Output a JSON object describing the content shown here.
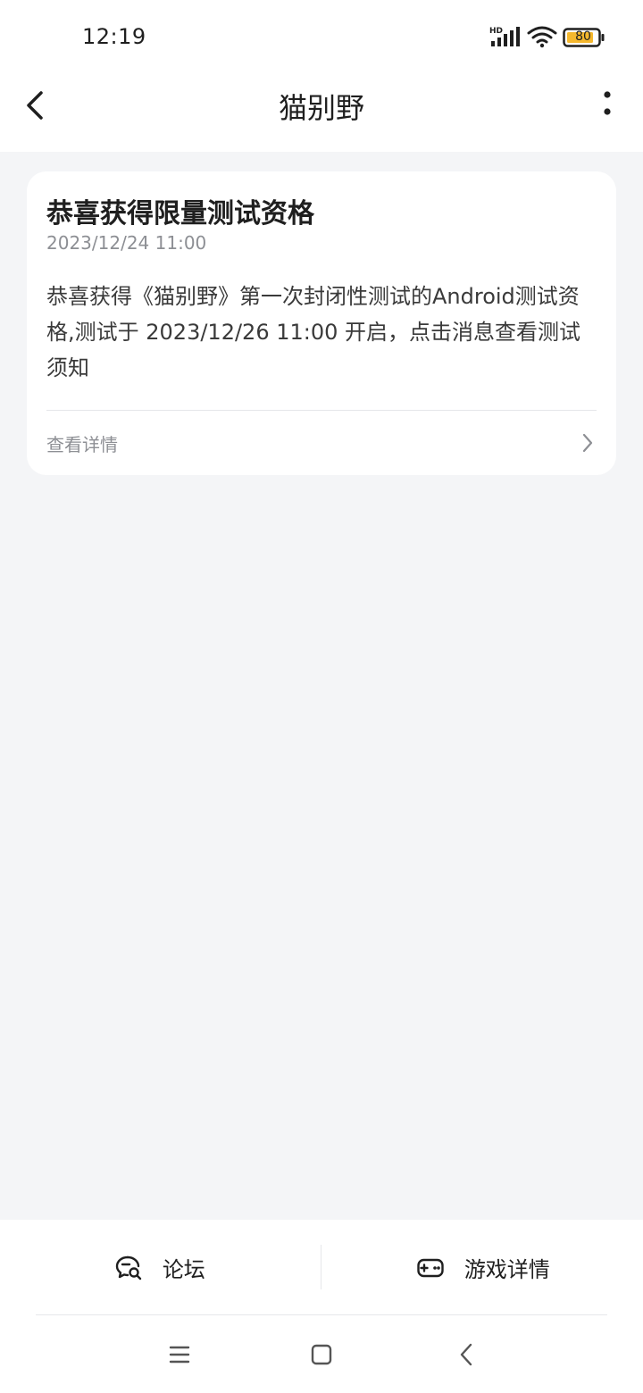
{
  "status_bar": {
    "time": "12:19",
    "battery": "80",
    "signal_label": "HD",
    "icons": [
      "signal-icon",
      "wifi-icon",
      "battery-icon"
    ]
  },
  "header": {
    "title": "猫别野",
    "back_icon": "back-arrow-icon",
    "more_icon": "more-vertical-icon"
  },
  "message": {
    "title": "恭喜获得限量测试资格",
    "time": "2023/12/24 11:00",
    "body": "恭喜获得《猫别野》第一次封闭性测试的Android测试资格,测试于 2023/12/26 11:00 开启，点击消息查看测试须知",
    "link_label": "查看详情",
    "link_icon": "chevron-right-icon"
  },
  "bottom_bar": {
    "forum_label": "论坛",
    "forum_icon": "chat-search-icon",
    "game_details_label": "游戏详情",
    "game_details_icon": "gamepad-icon"
  },
  "nav_bar": {
    "icons": [
      "menu-icon",
      "home-square-icon",
      "back-chevron-icon"
    ]
  },
  "colors": {
    "background": "#f4f5f7",
    "card": "#ffffff",
    "text_primary": "#1f1f1f",
    "text_secondary": "#8d8f94",
    "battery_fill": "#f5b82e"
  }
}
